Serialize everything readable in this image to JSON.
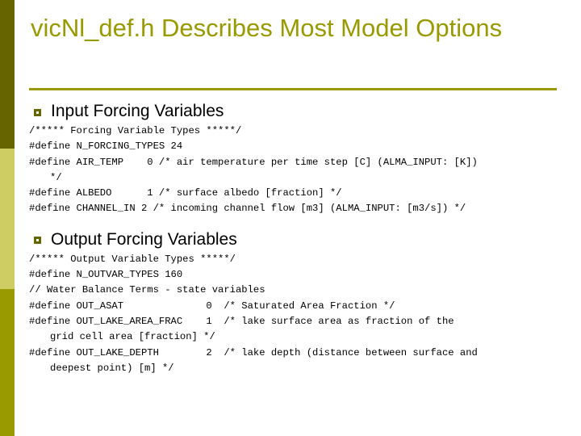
{
  "slide": {
    "title": "vicNl_def.h Describes Most Model Options",
    "accent_colors": {
      "segment_top": "#656400",
      "segment_middle": "#cdcd63",
      "segment_bottom": "#999900",
      "title": "#999900",
      "rule": "#999900",
      "bullet": "#666600"
    },
    "sections": [
      {
        "bullet_icon": "square-bullet-icon",
        "heading": "Input Forcing Variables",
        "code_lines": [
          {
            "text": "/***** Forcing Variable Types *****/",
            "continuation": false
          },
          {
            "text": "#define N_FORCING_TYPES 24",
            "continuation": false
          },
          {
            "text": "#define AIR_TEMP    0 /* air temperature per time step [C] (ALMA_INPUT: [K])",
            "continuation": false
          },
          {
            "text": "*/",
            "continuation": true
          },
          {
            "text": "#define ALBEDO      1 /* surface albedo [fraction] */",
            "continuation": false
          },
          {
            "text": "#define CHANNEL_IN 2 /* incoming channel flow [m3] (ALMA_INPUT: [m3/s]) */",
            "continuation": false
          }
        ]
      },
      {
        "bullet_icon": "square-bullet-icon",
        "heading": "Output Forcing Variables",
        "code_lines": [
          {
            "text": "/***** Output Variable Types *****/",
            "continuation": false
          },
          {
            "text": "#define N_OUTVAR_TYPES 160",
            "continuation": false
          },
          {
            "text": "// Water Balance Terms - state variables",
            "continuation": false
          },
          {
            "text": "#define OUT_ASAT              0  /* Saturated Area Fraction */",
            "continuation": false
          },
          {
            "text": "#define OUT_LAKE_AREA_FRAC    1  /* lake surface area as fraction of the",
            "continuation": false
          },
          {
            "text": "grid cell area [fraction] */",
            "continuation": true
          },
          {
            "text": "#define OUT_LAKE_DEPTH        2  /* lake depth (distance between surface and",
            "continuation": false
          },
          {
            "text": "deepest point) [m] */",
            "continuation": true
          }
        ]
      }
    ]
  }
}
